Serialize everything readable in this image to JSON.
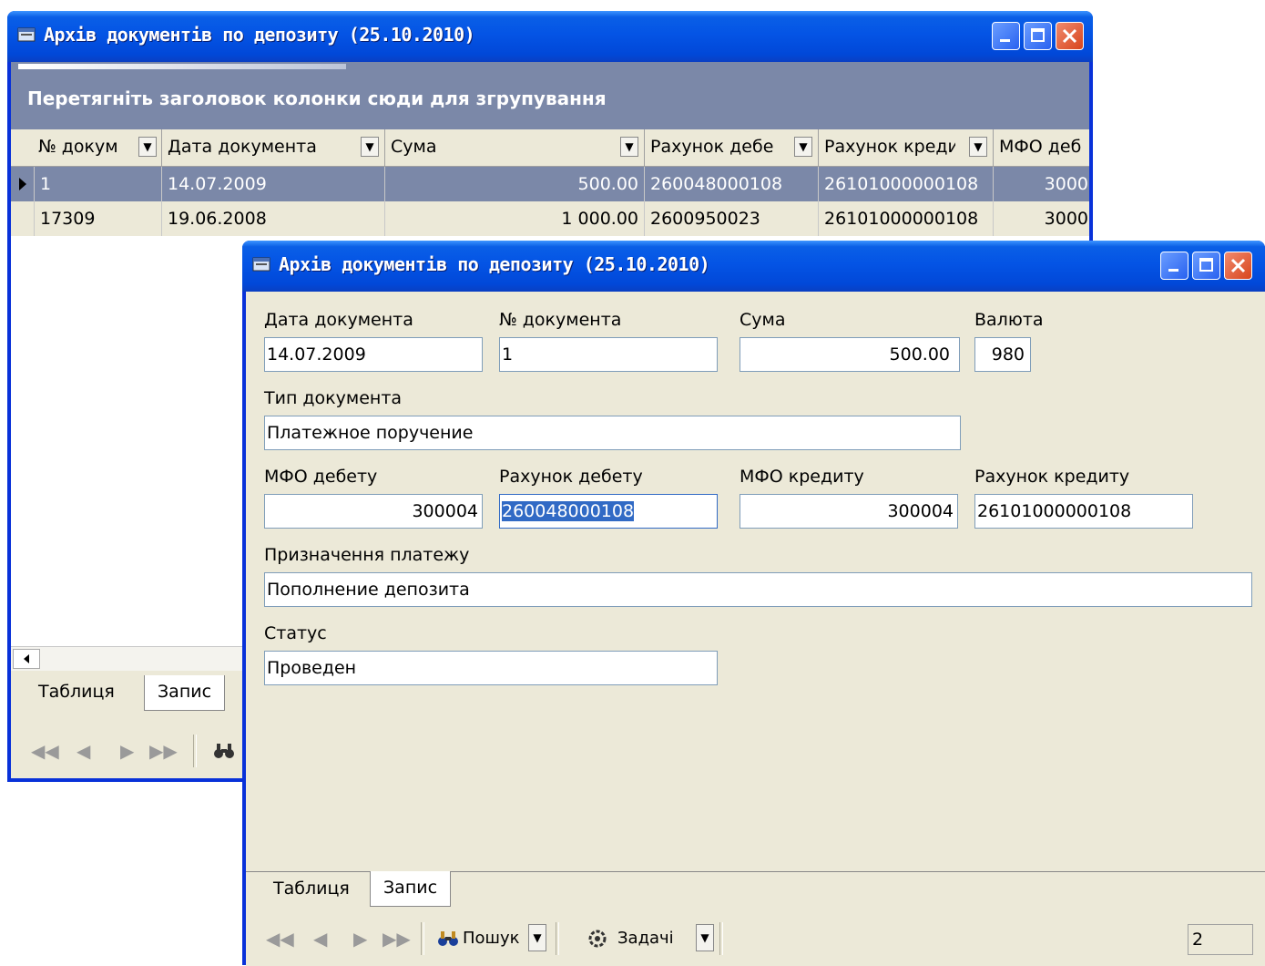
{
  "back_window": {
    "title": "Архів документів по депозиту (25.10.2010)",
    "group_hint": "Перетягніть заголовок колонки сюди для згрупування",
    "columns": [
      "№ докум",
      "Дата документа",
      "Сума",
      "Рахунок дебе",
      "Рахунок креди",
      "МФО деб"
    ],
    "rows": [
      {
        "num": "1",
        "date": "14.07.2009",
        "sum": "500.00",
        "debit": "260048000108",
        "credit": "26101000000108",
        "mfo": "3000"
      },
      {
        "num": "17309",
        "date": "19.06.2008",
        "sum": "1 000.00",
        "debit": "2600950023",
        "credit": "26101000000108",
        "mfo": "3000"
      }
    ],
    "tabs": [
      "Таблиця",
      "Запис"
    ]
  },
  "front_window": {
    "title": "Архів документів по депозиту (25.10.2010)",
    "form": {
      "date_label": "Дата документа",
      "date_value": "14.07.2009",
      "num_label": "№ документа",
      "num_value": "1",
      "sum_label": "Сума",
      "sum_value": "500.00",
      "currency_label": "Валюта",
      "currency_value": "980",
      "doctype_label": "Тип документа",
      "doctype_value": "Платежное поручение",
      "mfo_debit_label": "МФО дебету",
      "mfo_debit_value": "300004",
      "acc_debit_label": "Рахунок дебету",
      "acc_debit_value": "260048000108",
      "mfo_credit_label": "МФО кредиту",
      "mfo_credit_value": "300004",
      "acc_credit_label": "Рахунок кредиту",
      "acc_credit_value": "26101000000108",
      "purpose_label": "Призначення платежу",
      "purpose_value": "Пополнение депозита",
      "status_label": "Статус",
      "status_value": "Проведен"
    },
    "tabs": [
      "Таблиця",
      "Запис"
    ],
    "toolbar": {
      "search_label": "Пошук",
      "tasks_label": "Задачі",
      "record_counter": "2"
    }
  },
  "colors": {
    "titlebar": "#0454e5",
    "client": "#ece9d8",
    "selection": "#316ac5",
    "group_bar": "#7b88a8"
  }
}
